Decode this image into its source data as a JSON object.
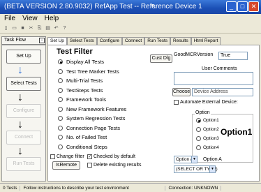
{
  "window": {
    "title": "(BETA VERSION 2.80.9032) RefApp Test -- Reference Device 1",
    "min": "_",
    "max": "□",
    "close": "✕"
  },
  "menu": [
    "File",
    "View",
    "Help"
  ],
  "taskflow": {
    "tab_label": "Task Flow",
    "buttons": [
      "Set Up",
      "Select Tests",
      "Configure",
      "Connect",
      "Run Tests"
    ]
  },
  "tabs": [
    "Set Up",
    "Select Tests",
    "Configure",
    "Connect",
    "Run Tests",
    "Results",
    "Html Report"
  ],
  "test_filter": {
    "title": "Test Filter",
    "options": [
      "Display All Tests",
      "Test Tree Marker Tests",
      "Multi-Trial Tests",
      "TestSteps Tests",
      "Framework Tools",
      "New Framework Features",
      "System Regression Tests",
      "Connection Page Tests",
      "No. of Failed Test",
      "Conditional Steps"
    ],
    "selected_index": 0
  },
  "change_filter": "Change filter",
  "checked_by_default": "Checked by default",
  "is_remote": "IsRemote",
  "delete_existing": "Delete existing results",
  "cust_dlg": "Cust Dlg",
  "good_mcr_label": "GoodMCRVersion",
  "good_mcr_value": "True",
  "user_comments_label": "User Comments",
  "choose_button": "Choose",
  "device_address_placeholder": "Device Address",
  "automate_label": "Automate External Device:",
  "option_group": {
    "label": "Option",
    "items": [
      "Option1",
      "Option2",
      "Option3",
      "Option4"
    ],
    "selected_index": 0,
    "display": "Option1"
  },
  "select_a": {
    "value": "Option A",
    "label": "Option A"
  },
  "select_type": {
    "value": "(SELECT OR TYPE)"
  },
  "status": {
    "tests": "0 Tests",
    "message": "Follow instructions to describe your test environment",
    "connection": "Connection: UNKNOWN"
  }
}
